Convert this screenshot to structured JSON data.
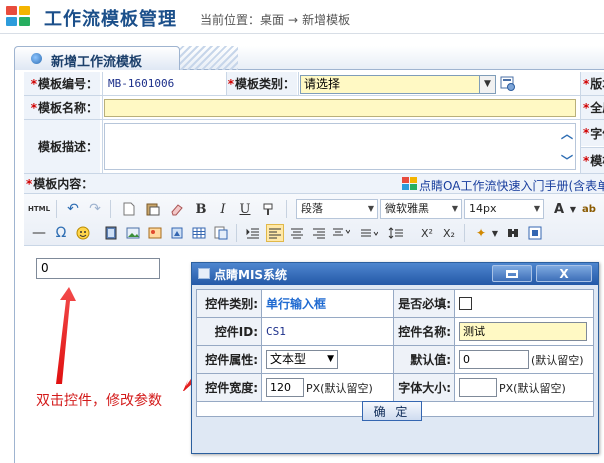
{
  "header": {
    "title": "工作流模板管理",
    "breadcrumb_prefix": "当前位置：",
    "breadcrumb_home": "桌面",
    "breadcrumb_arrow": "→",
    "breadcrumb_current": "新增模板"
  },
  "panel": {
    "tab_label": "新增工作流模板"
  },
  "form": {
    "template_no_label": "模板编号：",
    "template_no_value": "MB-1601006",
    "template_type_label": "模板类别：",
    "template_type_value": "请选择",
    "version_label": "版本",
    "template_name_label": "模板名称：",
    "global_label": "全局字",
    "template_desc_label": "模板描述：",
    "font_label": "字体大",
    "template_width_label": "模板宽",
    "template_content_label": "模板内容：",
    "manual_link": "点睛OA工作流快速入门手册(含表单"
  },
  "toolbar": {
    "html_label": "HTML",
    "paragraph": "段落",
    "font": "微软雅黑",
    "size": "14px",
    "bold": "B",
    "italic": "I",
    "underline": "U",
    "font_color": "A"
  },
  "editor": {
    "field_value": "0",
    "annotation": "双击控件，修改参数"
  },
  "dialog": {
    "title": "点睛MIS系统",
    "close": "X",
    "control_type_label": "控件类别:",
    "control_type_value": "单行输入框",
    "required_label": "是否必填:",
    "control_id_label": "控件ID:",
    "control_id_value": "CS1",
    "control_name_label": "控件名称:",
    "control_name_value": "测试",
    "attr_label": "控件属性:",
    "attr_value": "文本型",
    "default_label": "默认值:",
    "default_value": "0",
    "default_hint": "(默认留空)",
    "width_label": "控件宽度:",
    "width_value": "120",
    "width_hint": "PX(默认留空)",
    "fontsize_label": "字体大小:",
    "fontsize_value": "",
    "fontsize_hint": "PX(默认留空)",
    "ok": "确 定"
  },
  "colors": {
    "brand_blue": "#1b4f8a",
    "required_red": "#d10000",
    "annotation_red": "#d31a1a",
    "dialog_title": "#2459a7",
    "field_yellow": "#fff9c4"
  }
}
